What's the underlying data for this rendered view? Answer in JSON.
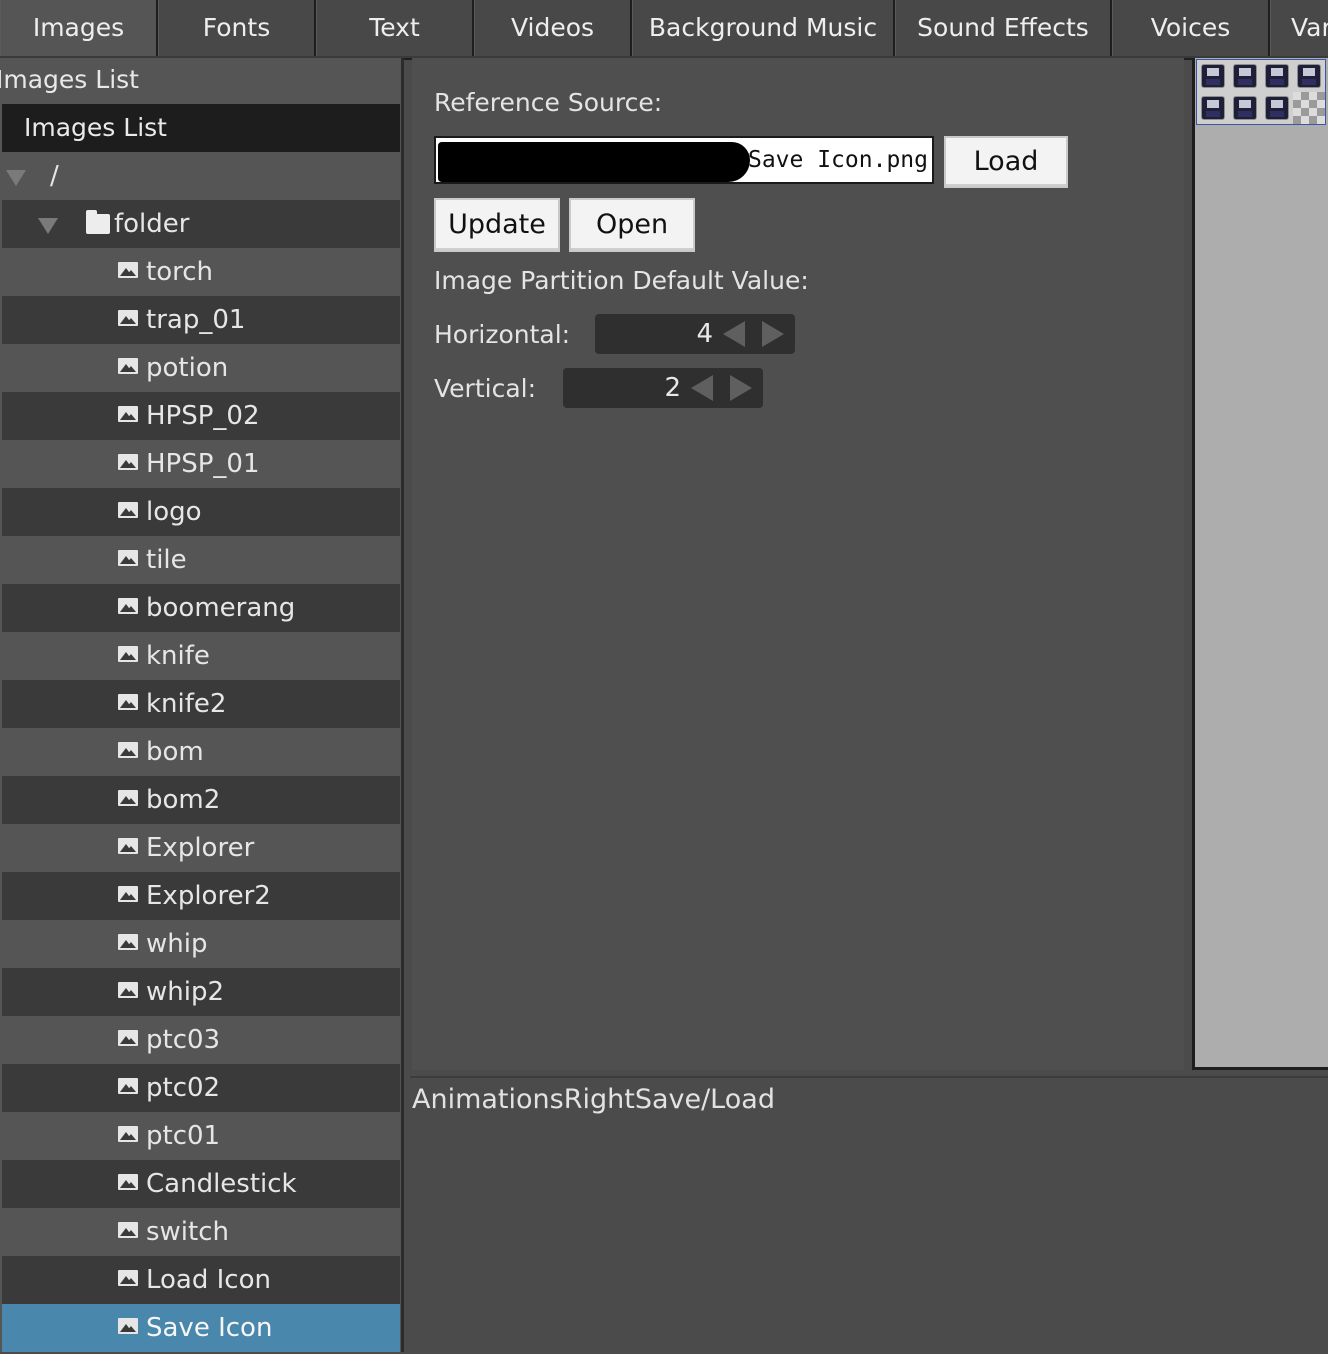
{
  "tabs": [
    {
      "label": "Images",
      "active": true
    },
    {
      "label": "Fonts"
    },
    {
      "label": "Text"
    },
    {
      "label": "Videos"
    },
    {
      "label": "Background Music"
    },
    {
      "label": "Sound Effects"
    },
    {
      "label": "Voices"
    },
    {
      "label": "Var"
    }
  ],
  "left_panel": {
    "title": "Images List",
    "list_header": "Images List",
    "root": "/",
    "folder": "folder",
    "items": [
      "torch",
      "trap_01",
      "potion",
      "HPSP_02",
      "HPSP_01",
      "logo",
      "tile",
      "boomerang",
      "knife",
      "knife2",
      "bom",
      "bom2",
      "Explorer",
      "Explorer2",
      "whip",
      "whip2",
      "ptc03",
      "ptc02",
      "ptc01",
      "Candlestick",
      "switch",
      "Load Icon",
      "Save Icon"
    ],
    "selected": "Save Icon"
  },
  "main": {
    "reference_label": "Reference Source:",
    "path_value": "/Save Icon.png",
    "load_label": "Load",
    "update_label": "Update",
    "open_label": "Open",
    "partition_label": "Image Partition Default Value:",
    "horizontal_label": "Horizontal:",
    "horizontal_value": "4",
    "vertical_label": "Vertical:",
    "vertical_value": "2"
  },
  "bottom": {
    "text": "AnimationsRightSave/Load"
  },
  "colors": {
    "selected_row": "#4a87ad",
    "background": "#4b4b4b"
  }
}
